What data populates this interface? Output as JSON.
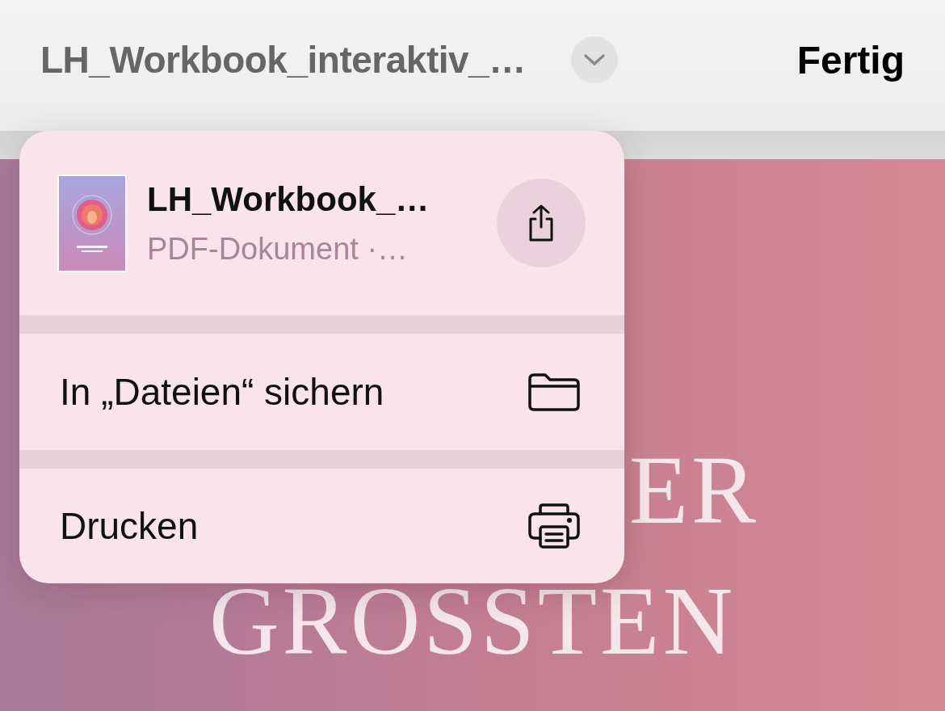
{
  "navigation_bar": {
    "title": "LH_Workbook_interaktiv_…",
    "done_button": "Fertig"
  },
  "menu": {
    "file": {
      "name": "LH_Workbook_…",
      "details": "PDF-Dokument ·…"
    },
    "items": [
      {
        "label": "In „Dateien“ sichern",
        "kind": "folder"
      },
      {
        "label": "Drucken",
        "kind": "printer"
      }
    ]
  },
  "document": {
    "lines": [
      "ER",
      "GROSSTEN"
    ]
  }
}
